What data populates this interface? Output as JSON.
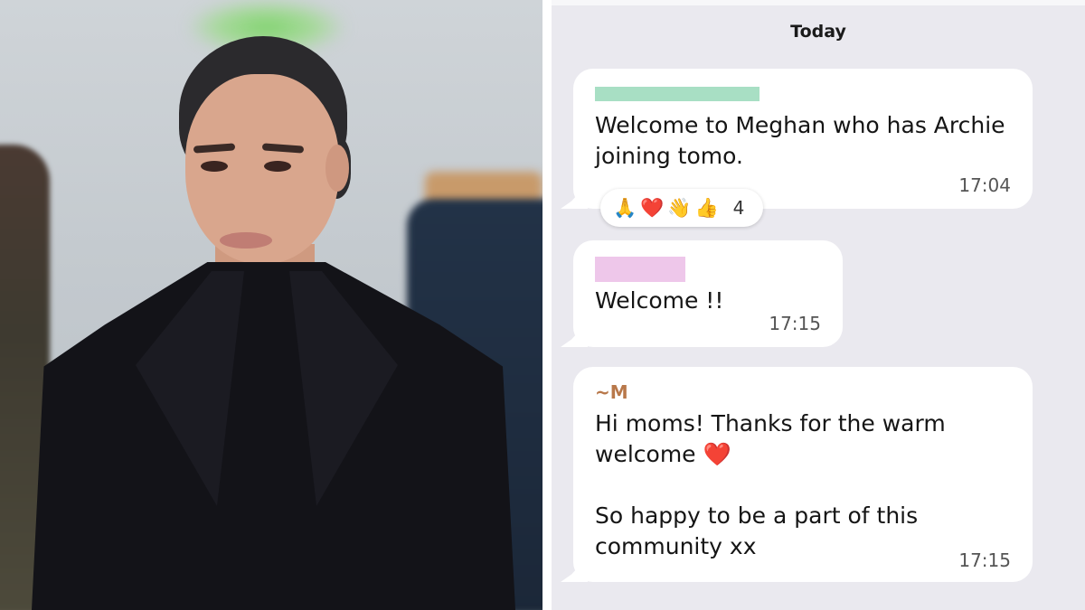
{
  "chat": {
    "date_header": "Today",
    "messages": [
      {
        "sender": "",
        "redaction_color": "#a8dfc4",
        "text": "Welcome to Meghan who has Archie\njoining tomo.",
        "time": "17:04",
        "reactions": {
          "emojis": [
            "🙏",
            "❤️",
            "👋",
            "👍"
          ],
          "count": "4"
        }
      },
      {
        "sender": "",
        "redaction_color": "#eec7ea",
        "text": "Welcome !!",
        "time": "17:15"
      },
      {
        "sender": "~M",
        "text": "Hi moms! Thanks for the warm\nwelcome ❤️\n\nSo happy to be a part of this\ncommunity xx",
        "time": "17:15"
      }
    ]
  },
  "colors": {
    "chat_background": "#eae9ef",
    "bubble": "#ffffff",
    "sender_name": "#b8784a"
  }
}
